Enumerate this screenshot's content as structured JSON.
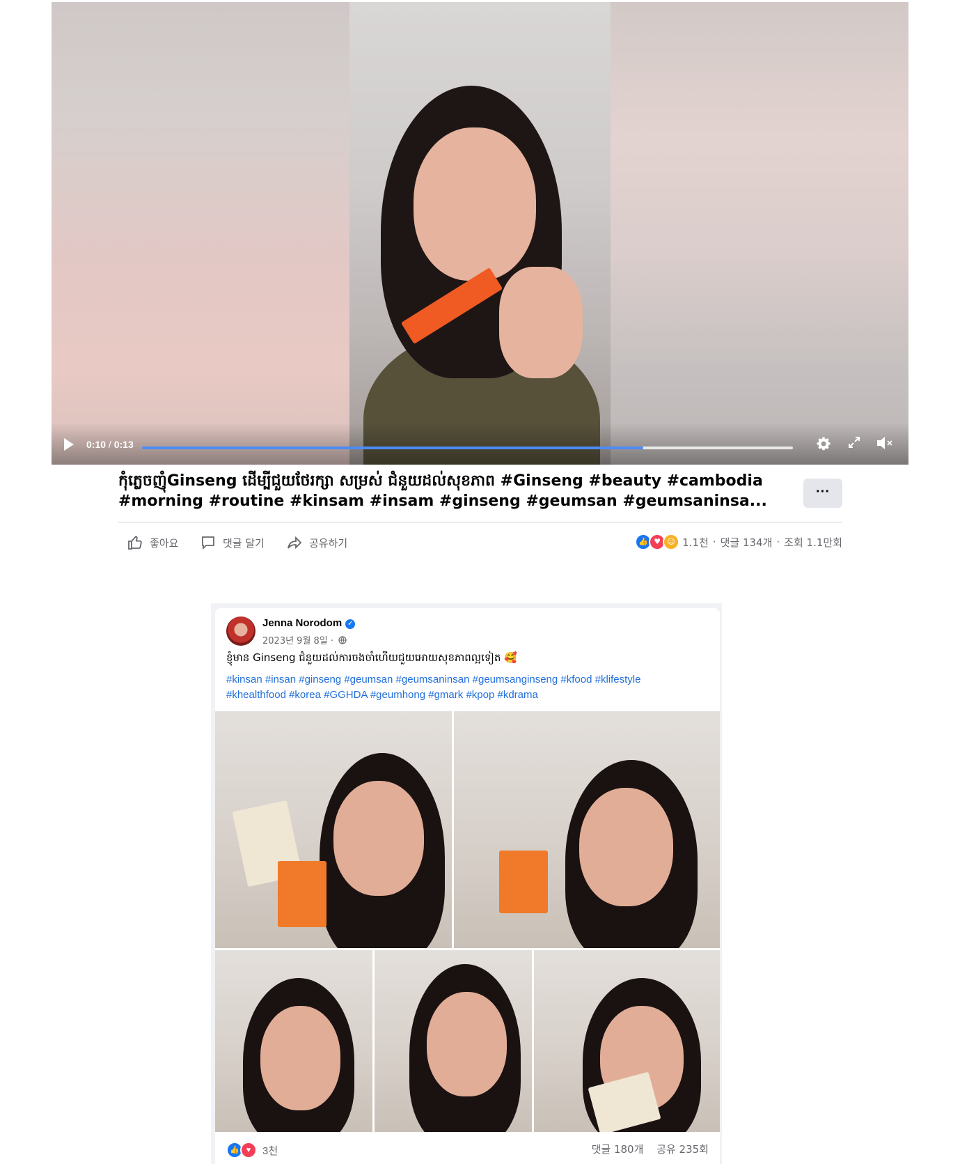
{
  "video": {
    "current_time": "0:10",
    "separator": " / ",
    "duration": "0:13",
    "progress_fraction": 0.77
  },
  "title": "កុំភ្លេចញុំGinseng ដើម្បីជួយថែរក្សា សម្រស់ ជំនួយដល់សុខភាព #Ginseng #beauty #cambodia #morning #routine #kinsam #insam #ginseng #geumsan #geumsaninsa...",
  "more_label": "···",
  "actions": {
    "like": "좋아요",
    "comment": "댓글 달기",
    "share": "공유하기"
  },
  "stats": {
    "reactions": "1.1천",
    "comments": "댓글 134개",
    "views": "조회 1.1만회",
    "dot": "·"
  },
  "post": {
    "author": "Jenna Norodom",
    "verified_mark": "✓",
    "date": "2023년 9월 8일 ·",
    "text": "ខ្ញុំមាន Ginseng ជំនួយដល់ការចងចាំហើយជួយអោយសុខភាពល្អទៀត 🥰",
    "hashtags_line1": [
      "#kinsan",
      "#insan",
      "#ginseng",
      "#geumsan",
      "#geumsaninsan",
      "#geumsanginseng",
      "#kfood",
      "#klifestyle"
    ],
    "hashtags_line2": [
      "#khealthfood",
      "#korea",
      "#GGHDA",
      "#geumhong",
      "#gmark",
      "#kpop",
      "#kdrama"
    ],
    "reactions": "3천",
    "comments": "댓글 180개",
    "shares": "공유 235회"
  },
  "colors": {
    "accent": "#1877f2",
    "progress": "#4d8bf5",
    "link": "#216fdb",
    "muted": "#65676b"
  },
  "icons": {
    "play": "play-icon",
    "settings": "gear-icon",
    "fullscreen": "fullscreen-icon",
    "mute": "muted-speaker-icon",
    "like": "thumbs-up-icon",
    "comment": "speech-bubble-icon",
    "share": "share-arrow-icon",
    "globe": "globe-icon"
  }
}
